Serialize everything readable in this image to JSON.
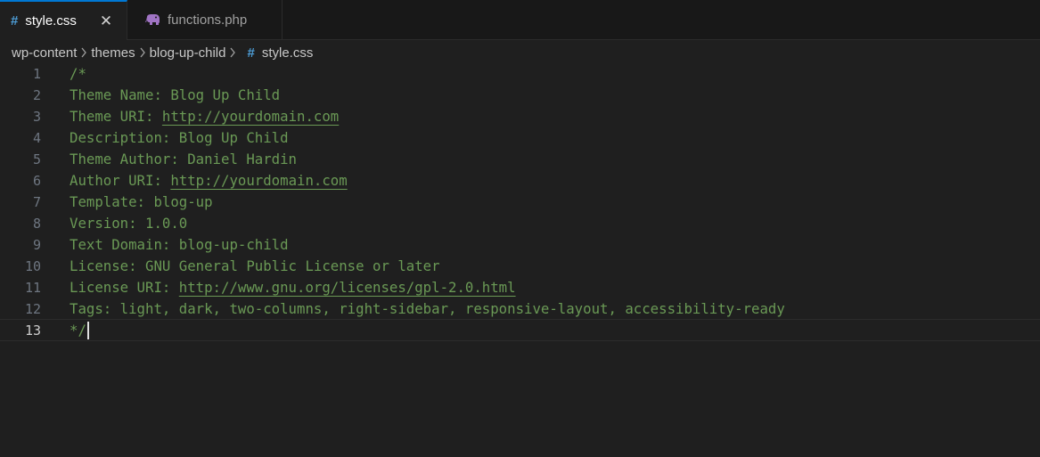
{
  "tabs": [
    {
      "label": "style.css",
      "icon": "css-hash-icon",
      "active": true,
      "close": "✕"
    },
    {
      "label": "functions.php",
      "icon": "php-elephant-icon",
      "active": false
    }
  ],
  "breadcrumb": {
    "items": [
      "wp-content",
      "themes",
      "blog-up-child"
    ],
    "file": "style.css"
  },
  "editor": {
    "active_line": 13,
    "line_numbers": [
      "1",
      "2",
      "3",
      "4",
      "5",
      "6",
      "7",
      "8",
      "9",
      "10",
      "11",
      "12",
      "13"
    ],
    "lines": {
      "l1": "/*",
      "l2": "Theme Name: Blog Up Child",
      "l3_pre": "Theme URI: ",
      "l3_link": "http://yourdomain.com",
      "l4": "Description: Blog Up Child",
      "l5": "Theme Author: Daniel Hardin",
      "l6_pre": "Author URI: ",
      "l6_link": "http://yourdomain.com",
      "l7": "Template: blog-up",
      "l8": "Version: 1.0.0",
      "l9": "Text Domain: blog-up-child",
      "l10": "License: GNU General Public License or later",
      "l11_pre": "License URI: ",
      "l11_link": "http://www.gnu.org/licenses/gpl-2.0.html",
      "l12": "Tags: light, dark, two-columns, right-sidebar, responsive-layout, accessibility-ready",
      "l13": "*/"
    }
  },
  "colors": {
    "background": "#1f1f1f",
    "comment": "#6a9955",
    "accent": "#0078d4",
    "css_icon": "#4d9dd6",
    "php_icon": "#a074c4"
  }
}
